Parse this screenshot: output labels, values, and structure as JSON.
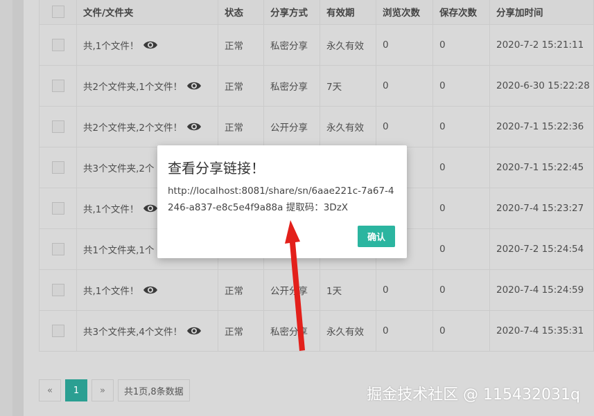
{
  "table": {
    "headers": [
      "文件/文件夹",
      "状态",
      "分享方式",
      "有效期",
      "浏览次数",
      "保存次数",
      "分享加时间"
    ],
    "rows": [
      {
        "name": "共,1个文件！",
        "status": "正常",
        "mode": "私密分享",
        "mode_type": "private",
        "validity": "永久有效",
        "views": "0",
        "saves": "0",
        "time": "2020-7-2 15:21:11"
      },
      {
        "name": "共2个文件夹,1个文件！",
        "status": "正常",
        "mode": "私密分享",
        "mode_type": "private",
        "validity": "7天",
        "views": "0",
        "saves": "0",
        "time": "2020-6-30 15:22:28"
      },
      {
        "name": "共2个文件夹,2个文件！",
        "status": "正常",
        "mode": "公开分享",
        "mode_type": "public",
        "validity": "永久有效",
        "views": "0",
        "saves": "0",
        "time": "2020-7-1 15:22:36"
      },
      {
        "name": "共3个文件夹,2个",
        "status": "",
        "mode": "",
        "mode_type": "private",
        "validity": "",
        "views": "",
        "saves": "0",
        "time": "2020-7-1 15:22:45"
      },
      {
        "name": "共,1个文件！",
        "status": "",
        "mode": "",
        "mode_type": "private",
        "validity": "",
        "views": "",
        "saves": "0",
        "time": "2020-7-4 15:23:27"
      },
      {
        "name": "共1个文件夹,1个",
        "status": "",
        "mode": "",
        "mode_type": "private",
        "validity": "",
        "views": "",
        "saves": "0",
        "time": "2020-7-2 15:24:54"
      },
      {
        "name": "共,1个文件！",
        "status": "正常",
        "mode": "公开分享",
        "mode_type": "public",
        "validity": "1天",
        "views": "0",
        "saves": "0",
        "time": "2020-7-4 15:24:59"
      },
      {
        "name": "共3个文件夹,4个文件！",
        "status": "正常",
        "mode": "私密分享",
        "mode_type": "private",
        "validity": "永久有效",
        "views": "0",
        "saves": "0",
        "time": "2020-7-4 15:35:31"
      }
    ]
  },
  "pager": {
    "prev": "«",
    "current": "1",
    "next": "»",
    "info": "共1页,8条数据"
  },
  "modal": {
    "title": "查看分享链接！",
    "body": "http://localhost:8081/share/sn/6aae221c-7a67-4246-a837-e8c5e4f9a88a 提取码：3DzX",
    "confirm": "确认"
  },
  "watermark": "掘金技术社区 @ 115432031q",
  "colors": {
    "accent": "#2bb5a0",
    "status_ok": "#2e9f72",
    "public": "#d07a2a",
    "arrow": "#e3201b"
  }
}
